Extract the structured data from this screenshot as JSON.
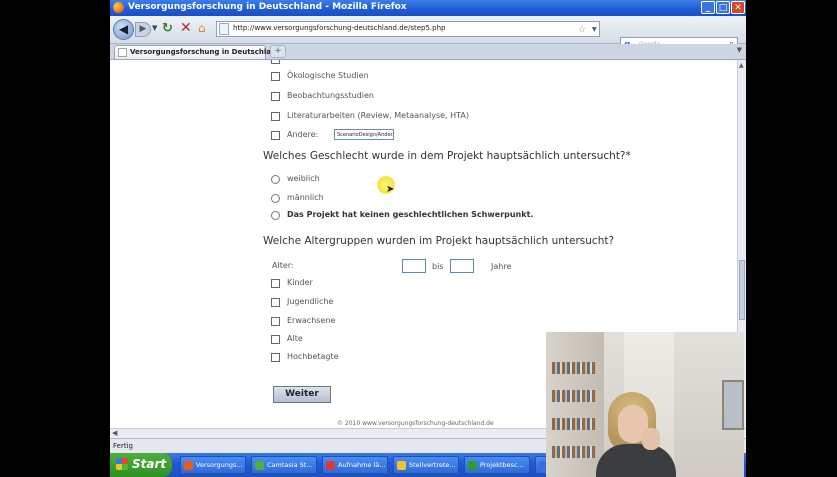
{
  "window": {
    "title": "Versorgungsforschung in Deutschland - Mozilla Firefox",
    "controls": {
      "minimize": "_",
      "maximize": "□",
      "close": "✕"
    }
  },
  "navbar": {
    "url": "http://www.versorgungsforschung-deutschland.de/step5.php",
    "search_engine": "g",
    "search_placeholder": "Google"
  },
  "tabs": [
    {
      "label": "Versorgungsforschung in Deutschland"
    }
  ],
  "form": {
    "study_types": [
      {
        "label": "Ökologische Studien"
      },
      {
        "label": "Beobachtungsstudien"
      },
      {
        "label": "Literaturarbeiten (Review, Metaanalyse, HTA)"
      },
      {
        "label": "Andere:",
        "value": "ScenarioDesign/Ander"
      }
    ],
    "gender_question": "Welches Geschlecht wurde in dem Projekt hauptsächlich untersucht?*",
    "gender_options": [
      {
        "label": "weiblich"
      },
      {
        "label": "männlich"
      },
      {
        "label": "Das Projekt hat keinen geschlechtlichen Schwerpunkt."
      }
    ],
    "age_question": "Welche Altergruppen wurden im Projekt hauptsächlich untersucht?",
    "age_label": "Alter:",
    "age_bis": "bis",
    "age_unit": "Jahre",
    "age_groups": [
      {
        "label": "Kinder"
      },
      {
        "label": "Jugendliche"
      },
      {
        "label": "Erwachsene"
      },
      {
        "label": "Alte"
      },
      {
        "label": "Hochbetagte"
      }
    ],
    "submit_label": "Weiter",
    "footer": "© 2010 www.versorgungsforschung-deutschland.de"
  },
  "statusbar": {
    "text": "Fertig"
  },
  "taskbar": {
    "start_label": "Start",
    "items": [
      {
        "label": "Versorgungs...",
        "color": "#e8591d"
      },
      {
        "label": "Camtasia St...",
        "color": "#4fae3e"
      },
      {
        "label": "Aufnahme lä...",
        "color": "#d63b3b"
      },
      {
        "label": "Stellvertrete...",
        "color": "#f0c330"
      },
      {
        "label": "Projektbesc...",
        "color": "#2e9b2e"
      },
      {
        "label": "",
        "color": "#3a6fd8"
      }
    ]
  }
}
